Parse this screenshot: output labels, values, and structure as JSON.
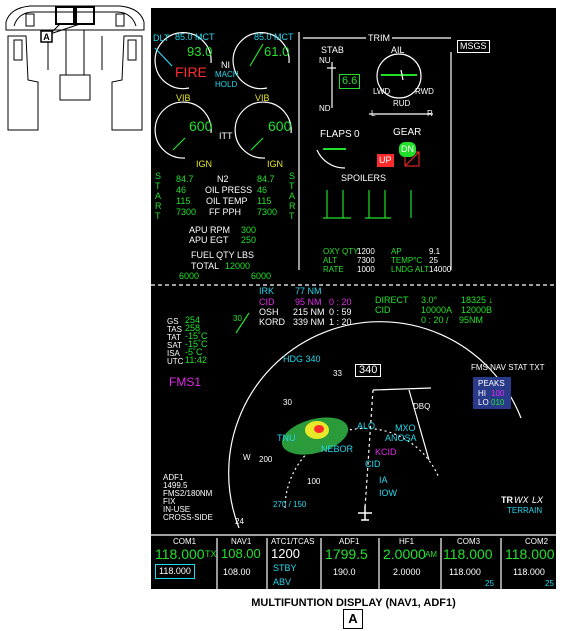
{
  "locator": {
    "marker": "A"
  },
  "caption": {
    "title": "MULTIFUNTION DISPLAY (NAV1, ADF1)",
    "ref": "A"
  },
  "eicas": {
    "n1_left": {
      "label": "DLT",
      "mct": "85.0 MCT",
      "value": "93.0",
      "warn": "FIRE",
      "vib": "VIB"
    },
    "n1_right": {
      "mct": "85.0 MCT",
      "value": "61.0",
      "vib": "VIB"
    },
    "n1_label": "NI",
    "mach_hold": [
      "MACH",
      "HOLD"
    ],
    "itt_left": {
      "value": "600",
      "ign": "IGN"
    },
    "itt_right": {
      "value": "600",
      "ign": "IGN"
    },
    "itt_label": "ITT",
    "start_left": [
      "S",
      "T",
      "A",
      "R",
      "T"
    ],
    "start_right": [
      "S",
      "T",
      "A",
      "R",
      "T"
    ],
    "table": {
      "labels": [
        "N2",
        "OIL PRESS",
        "OIL TEMP",
        "FF PPH"
      ],
      "left": [
        "84.7",
        "46",
        "115",
        "7300"
      ],
      "right": [
        "84.7",
        "46",
        "115",
        "7300"
      ]
    },
    "apu": {
      "rpm_label": "APU RPM",
      "rpm": "300",
      "egt_label": "APU EGT",
      "egt": "250"
    },
    "fuel": {
      "title": "FUEL QTY LBS",
      "total_label": "TOTAL",
      "total": "12000",
      "left": "6000",
      "right": "6000"
    }
  },
  "trim": {
    "title": "TRIM",
    "stab": "STAB",
    "nu": "NU",
    "nd": "ND",
    "stab_value": "6.6",
    "ail": "AIL",
    "lwd": "LWD",
    "rwd": "RWD",
    "rud": "RUD",
    "l": "L",
    "r": "R"
  },
  "msgs": "MSGS",
  "flaps": {
    "label": "FLAPS",
    "value": "0"
  },
  "gear": {
    "label": "GEAR",
    "dn": "DN",
    "up": "UP"
  },
  "spoilers": "SPOILERS",
  "hyd": {
    "col1": [
      "OXY QTY",
      "ALT",
      "RATE"
    ],
    "col2": [
      "1200",
      "7300",
      "1000"
    ],
    "col3": [
      "AP",
      "TEMP°C",
      "LNDG ALT"
    ],
    "col4": [
      "9.1",
      "25",
      "14000"
    ]
  },
  "nav": {
    "irk": "IRK",
    "irk_dist": "77 NM",
    "rows": [
      {
        "id": "CID",
        "dist": "95 NM",
        "time": "0 : 20"
      },
      {
        "id": "OSH",
        "dist": "215 NM",
        "time": "0 : 59"
      },
      {
        "id": "KORD",
        "dist": "339 NM",
        "time": "1 : 20"
      }
    ],
    "direct": "DIRECT",
    "angle": "3.0°",
    "alt": "18325 ↓",
    "cid": "CID",
    "cid_alt": "10000A",
    "cid_b": "12000B",
    "cid_time": "0 : 20 /",
    "cid_dist": "95NM"
  },
  "air": {
    "labels": [
      "GS",
      "TAS",
      "TAT",
      "SAT",
      "ISA",
      "UTC"
    ],
    "values": [
      "254",
      "258",
      "-15˚C",
      "-15˚C",
      "-5˚C",
      "11:42"
    ]
  },
  "wind": "30",
  "map": {
    "hdg": "HDG 340",
    "hdg_box": "340",
    "fms": "FMS1",
    "compass": [
      "33",
      "30",
      "W",
      "24"
    ],
    "ranges": [
      "200",
      "100"
    ],
    "speed": "270 / 150",
    "points": [
      "DBQ",
      "ALO",
      "TNU",
      "MXO",
      "ANOSA",
      "NEBOR",
      "KCID",
      "CID",
      "IA",
      "IOW"
    ]
  },
  "fms_nav": "FMS NAV STAT TXT",
  "peaks": {
    "title": "PEAKS",
    "hi_label": "HI",
    "hi": "100",
    "lo_label": "LO",
    "lo": "010"
  },
  "nav_source": {
    "adf": "ADF1",
    "freq": "1499.5",
    "fms": "FMS2/180NM",
    "fix": "FIX",
    "inuse": "IN-USE",
    "cross": "CROSS-SIDE"
  },
  "wx": {
    "tr": "TR",
    "wx": "WX",
    "lx": "LX",
    "terrain": "TERRAIN"
  },
  "radio": {
    "com1": {
      "label": "COM1",
      "active": "118.000",
      "tx": "TX",
      "standby": "118.000"
    },
    "nav1": {
      "label": "NAV1",
      "active": "108.00",
      "standby": "108.00"
    },
    "atc": {
      "label": "ATC1/TCAS",
      "active": "1200",
      "stby": "STBY",
      "abv": "ABV"
    },
    "adf1": {
      "label": "ADF1",
      "active": "1799.5",
      "standby": "190.0"
    },
    "hf1": {
      "label": "HF1",
      "active": "2.0000",
      "am": "AM",
      "standby": "2.0000"
    },
    "com3": {
      "label": "COM3",
      "active": "118.000",
      "standby": "118.000",
      "ch": "25"
    },
    "com2": {
      "label": "COM2",
      "active": "118.000",
      "standby": "118.000",
      "ch": "25"
    }
  }
}
